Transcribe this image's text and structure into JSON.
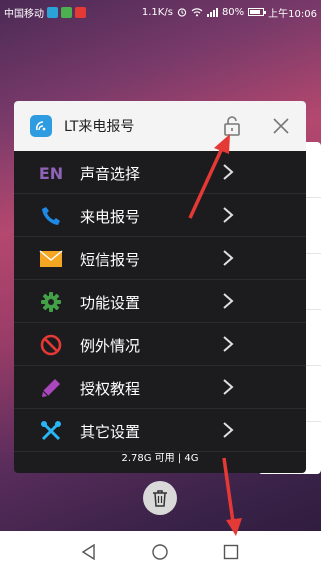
{
  "status_bar": {
    "carrier": "中国移动",
    "speed": "1.1K/s",
    "battery": "80%",
    "time": "上午10:06"
  },
  "app_card": {
    "title": "LT来电报号",
    "menu": [
      {
        "icon": "en-text-icon",
        "icon_text": "EN",
        "label": "声音选择"
      },
      {
        "icon": "phone-icon",
        "label": "来电报号"
      },
      {
        "icon": "envelope-icon",
        "label": "短信报号"
      },
      {
        "icon": "gear-icon",
        "label": "功能设置"
      },
      {
        "icon": "prohibited-icon",
        "label": "例外情况"
      },
      {
        "icon": "pencil-icon",
        "label": "授权教程"
      },
      {
        "icon": "tools-icon",
        "label": "其它设置"
      }
    ],
    "footer": "2.78G 可用 | 4G"
  },
  "colors": {
    "card_bg": "#1c1c1e",
    "header_bg": "#f4f4f4",
    "folder_green": "#4caf50",
    "folder_blue": "#2196f3",
    "arrow_red": "#e53935"
  }
}
